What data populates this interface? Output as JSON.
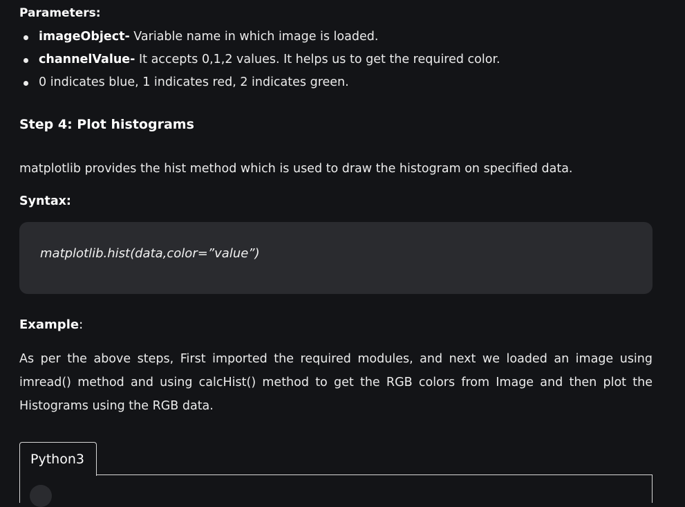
{
  "parameters": {
    "heading": "Parameters:",
    "items": [
      {
        "term": "imageObject-",
        "desc": " Variable name in which image is loaded."
      },
      {
        "term": "channelValue-",
        "desc": " It accepts 0,1,2 values. It helps us to get the required color."
      },
      {
        "term": "",
        "desc": "0 indicates blue, 1 indicates red, 2 indicates green."
      }
    ]
  },
  "step": {
    "heading": "Step 4: Plot histograms"
  },
  "intro_paragraph": "matplotlib provides the hist method which is used to draw the histogram on specified data.",
  "syntax": {
    "label": "Syntax:",
    "code": "matplotlib.hist(data,color=”value”)"
  },
  "example": {
    "label": "Example",
    "colon": ":",
    "paragraph": "As per the above steps, First imported the required modules, and next we loaded an image using imread() method and using calcHist() method to get the RGB colors from Image and then plot the Histograms using the RGB data."
  },
  "code_tabs": {
    "active_tab": "Python3"
  },
  "colors": {
    "background": "#131417",
    "code_block": "#2a2b2f",
    "text": "#ececec",
    "tab_border": "#d9d9d9"
  }
}
